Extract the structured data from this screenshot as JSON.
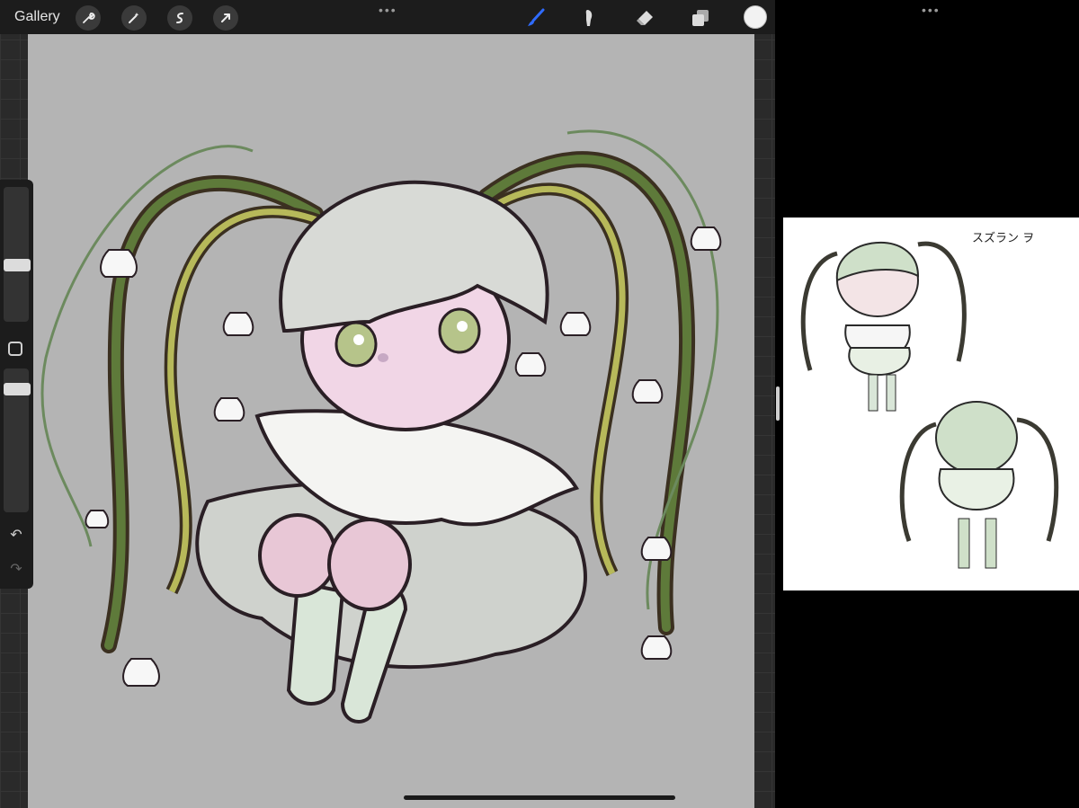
{
  "topbar": {
    "gallery_label": "Gallery",
    "tools_left": [
      "wrench-icon",
      "magic-wand-icon",
      "selection-icon",
      "transform-arrow-icon"
    ],
    "tools_right": [
      "brush-icon",
      "smudge-icon",
      "eraser-icon",
      "layers-icon"
    ],
    "active_tool": "brush-icon",
    "current_color": "#f2f2f2",
    "accent_color": "#2f6bff"
  },
  "reference_panel": {
    "label": "スズラン ヲ"
  },
  "sidebar": {
    "undo_icon": "↶",
    "redo_icon": "↷"
  }
}
